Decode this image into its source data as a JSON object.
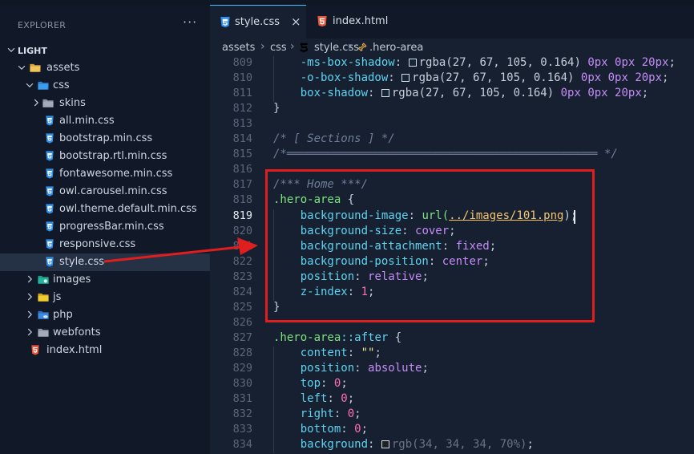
{
  "sidebar": {
    "title": "EXPLORER",
    "more": "···",
    "tree": [
      {
        "label": "LIGHT",
        "type": "root",
        "icon": "chevron-down-icon",
        "indent": 0
      },
      {
        "label": "assets",
        "type": "folder-open",
        "indent": 1
      },
      {
        "label": "css",
        "type": "css-folder-open",
        "indent": 2
      },
      {
        "label": "skins",
        "type": "folder-closed",
        "indent": 3
      },
      {
        "label": "all.min.css",
        "type": "css-file",
        "indent": 4
      },
      {
        "label": "bootstrap.min.css",
        "type": "css-file",
        "indent": 4
      },
      {
        "label": "bootstrap.rtl.min.css",
        "type": "css-file",
        "indent": 4
      },
      {
        "label": "fontawesome.min.css",
        "type": "css-file",
        "indent": 4
      },
      {
        "label": "owl.carousel.min.css",
        "type": "css-file",
        "indent": 4
      },
      {
        "label": "owl.theme.default.min.css",
        "type": "css-file",
        "indent": 4
      },
      {
        "label": "progressBar.min.css",
        "type": "css-file",
        "indent": 4
      },
      {
        "label": "responsive.css",
        "type": "css-file",
        "indent": 4
      },
      {
        "label": "style.css",
        "type": "css-file",
        "indent": 4,
        "selected": true
      },
      {
        "label": "images",
        "type": "images-folder",
        "indent": 2
      },
      {
        "label": "js",
        "type": "js-folder",
        "indent": 2
      },
      {
        "label": "php",
        "type": "php-folder",
        "indent": 2
      },
      {
        "label": "webfonts",
        "type": "folder-closed",
        "indent": 2
      },
      {
        "label": "index.html",
        "type": "html-file",
        "indent": 1
      }
    ]
  },
  "tabs": [
    {
      "label": "style.css",
      "icon": "css-file-icon",
      "active": true,
      "close": "×"
    },
    {
      "label": "index.html",
      "icon": "html-file-icon",
      "active": false
    }
  ],
  "breadcrumb": {
    "items": [
      "assets",
      "css",
      "style.css",
      ".hero-area"
    ],
    "separator": "›"
  },
  "code": {
    "active_line": 819,
    "lines": [
      {
        "n": 809,
        "indent": 1,
        "prop": "-ms-box-shadow",
        "value": "rgba(27, 67, 105, 0.164)",
        "offsets": "0px 0px 20px"
      },
      {
        "n": 810,
        "indent": 1,
        "prop": "-o-box-shadow",
        "value": "rgba(27, 67, 105, 0.164)",
        "offsets": "0px 0px 20px"
      },
      {
        "n": 811,
        "indent": 1,
        "prop": "box-shadow",
        "value": "rgba(27, 67, 105, 0.164)",
        "offsets": "0px 0px 20px"
      },
      {
        "n": 812,
        "text": "}"
      },
      {
        "n": 813,
        "text": ""
      },
      {
        "n": 814,
        "comment": "/* [ Sections ] */"
      },
      {
        "n": 815,
        "comment": "/*══════════════════════════════════════════════ */"
      },
      {
        "n": 816,
        "text": ""
      },
      {
        "n": 817,
        "comment": "/*** Home ***/"
      },
      {
        "n": 818,
        "selector": ".hero-area",
        "brace": " {"
      },
      {
        "n": 819,
        "indent": 1,
        "prop": "background-image",
        "url_fn": "url(",
        "url": "../images/101.png",
        "url_close": ");"
      },
      {
        "n": 820,
        "indent": 1,
        "prop": "background-size",
        "kw": "cover"
      },
      {
        "n": 821,
        "indent": 1,
        "prop": "background-attachment",
        "kw": "fixed"
      },
      {
        "n": 822,
        "indent": 1,
        "prop": "background-position",
        "kw": "center"
      },
      {
        "n": 823,
        "indent": 1,
        "prop": "position",
        "kw": "relative"
      },
      {
        "n": 824,
        "indent": 1,
        "prop": "z-index",
        "numval": "1"
      },
      {
        "n": 825,
        "text": "}"
      },
      {
        "n": 826,
        "text": ""
      },
      {
        "n": 827,
        "selector": ".hero-area",
        "pseudo": "::after",
        "brace": " {"
      },
      {
        "n": 828,
        "indent": 1,
        "prop": "content",
        "str": "\"\""
      },
      {
        "n": 829,
        "indent": 1,
        "prop": "position",
        "kw": "absolute"
      },
      {
        "n": 830,
        "indent": 1,
        "prop": "top",
        "numval": "0"
      },
      {
        "n": 831,
        "indent": 1,
        "prop": "left",
        "numval": "0"
      },
      {
        "n": 832,
        "indent": 1,
        "prop": "right",
        "numval": "0"
      },
      {
        "n": 833,
        "indent": 1,
        "prop": "bottom",
        "numval": "0"
      },
      {
        "n": 834,
        "indent": 1,
        "prop": "background",
        "dimval": "rgb(34, 34, 34, 70%)"
      }
    ]
  },
  "colors": {
    "accent": "#43c0ff",
    "callout": "#e01e1e",
    "property": "#5fd3f0",
    "number": "#ff6eb4",
    "keyword": "#c58cf7",
    "selector": "#7ee37e"
  }
}
